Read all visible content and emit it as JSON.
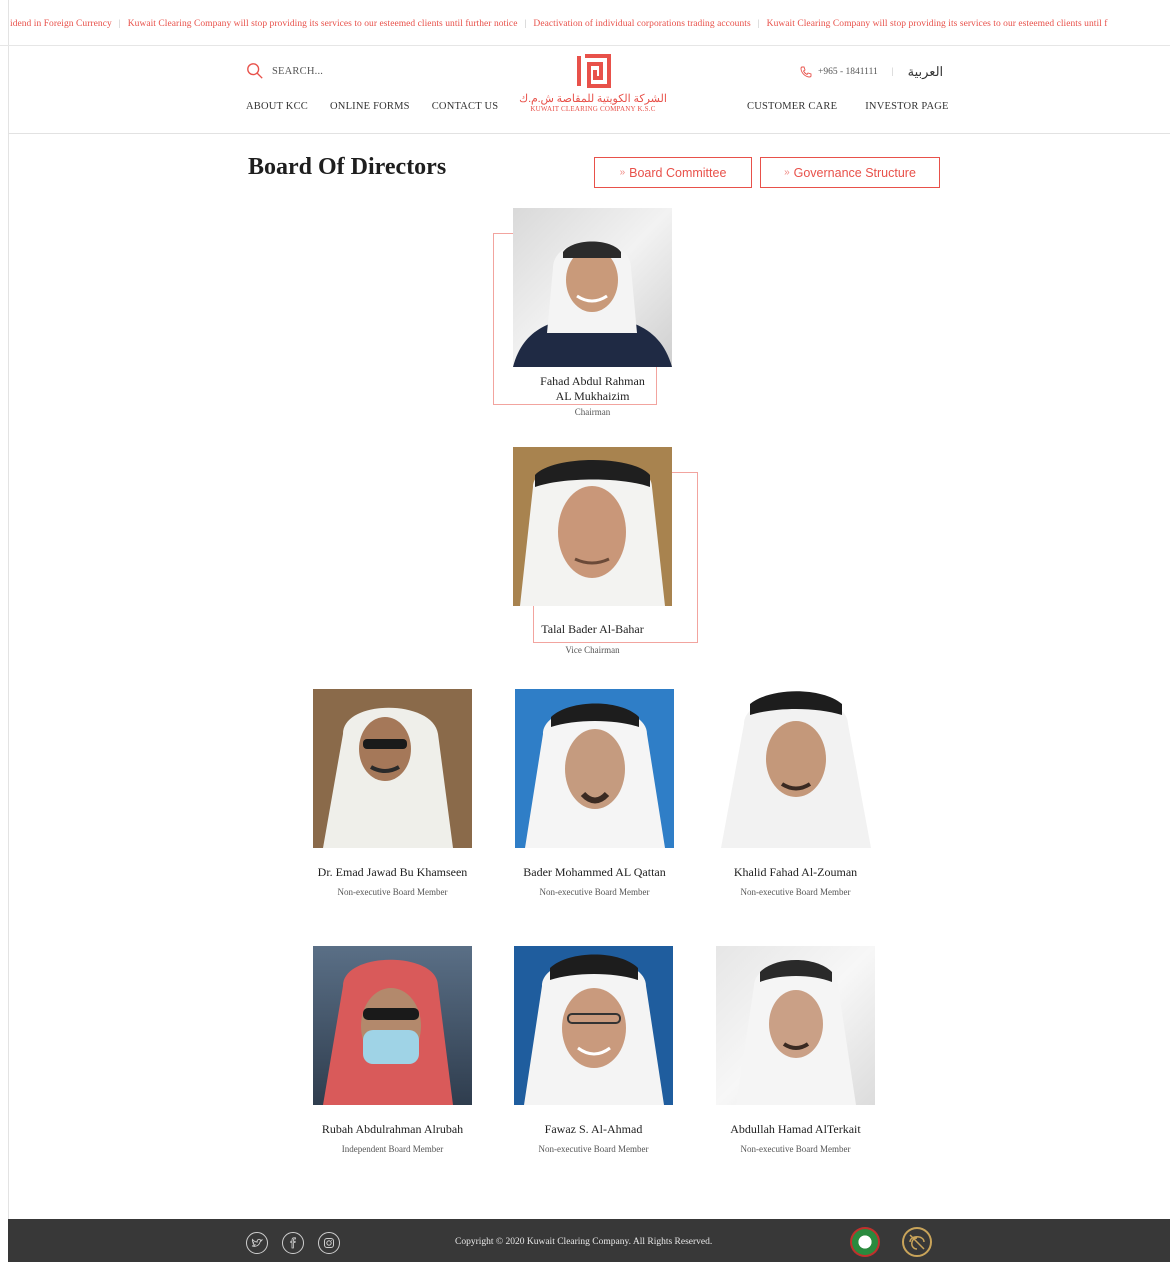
{
  "ticker": {
    "items": [
      "idend in Foreign Currency",
      "Kuwait Clearing Company will stop providing its services to our esteemed clients until further notice",
      "Deactivation of individual corporations trading accounts",
      "Kuwait Clearing Company will stop providing its services to our esteemed clients until f"
    ],
    "separator": "|"
  },
  "header": {
    "search_placeholder": "SEARCH...",
    "nav_left": [
      "ABOUT KCC",
      "ONLINE FORMS",
      "CONTACT US"
    ],
    "nav_right": [
      "CUSTOMER CARE",
      "INVESTOR PAGE"
    ],
    "logo_ar": "الشركة الكويتية للمقاصة ش.م.ك",
    "logo_en": "KUWAIT CLEARING COMPANY K.S.C",
    "phone": "+965 - 1841111",
    "language": "العربية",
    "accent": "#e8514a"
  },
  "main": {
    "title": "Board Of Directors",
    "buttons": {
      "committee": "Board Committee",
      "governance": "Governance Structure",
      "chevron": "»"
    },
    "chairman": {
      "name1": "Fahad Abdul Rahman",
      "name2": "AL Mukhaizim",
      "role": "Chairman"
    },
    "vice_chairman": {
      "name": "Talal Bader Al-Bahar",
      "role": "Vice Chairman"
    },
    "members": [
      {
        "name": "Dr. Emad Jawad Bu Khamseen",
        "role": "Non-executive Board Member"
      },
      {
        "name": "Bader Mohammed AL Qattan",
        "role": "Non-executive Board Member"
      },
      {
        "name": "Khalid Fahad Al-Zouman",
        "role": "Non-executive Board Member"
      },
      {
        "name": "Rubah Abdulrahman Alrubah",
        "role": "Independent Board Member"
      },
      {
        "name": "Fawaz S. Al-Ahmad",
        "role": "Non-executive Board Member"
      },
      {
        "name": "Abdullah Hamad AlTerkait",
        "role": "Non-executive Board Member"
      }
    ]
  },
  "footer": {
    "copyright": "Copyright © 2020 Kuwait Clearing Company. All Rights Reserved.",
    "social_icons": [
      "twitter-icon",
      "facebook-icon",
      "instagram-icon"
    ]
  }
}
